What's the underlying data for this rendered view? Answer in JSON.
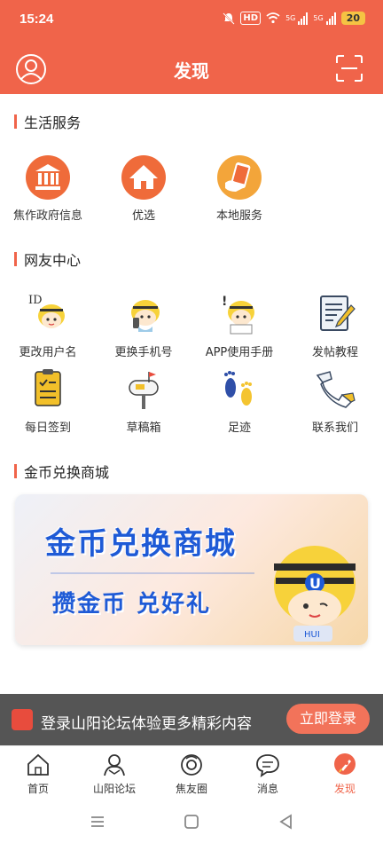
{
  "status": {
    "time": "15:24",
    "hd": "HD",
    "net1": "5G",
    "net2": "5G",
    "battery": "20"
  },
  "header": {
    "title": "发现",
    "avatar_icon": "user-avatar-icon",
    "scan_icon": "scan-icon"
  },
  "sections": {
    "life": {
      "title": "生活服务",
      "items": [
        {
          "label": "焦作政府信息",
          "icon": "government-building-icon"
        },
        {
          "label": "优选",
          "icon": "home-icon"
        },
        {
          "label": "本地服务",
          "icon": "local-service-icon"
        }
      ]
    },
    "community": {
      "title": "网友中心",
      "items": [
        {
          "label": "更改用户名",
          "icon": "mascot-id-icon"
        },
        {
          "label": "更换手机号",
          "icon": "mascot-phone-icon"
        },
        {
          "label": "APP使用手册",
          "icon": "mascot-manual-icon"
        },
        {
          "label": "发帖教程",
          "icon": "post-tutorial-icon"
        },
        {
          "label": "每日签到",
          "icon": "checkin-clipboard-icon"
        },
        {
          "label": "草稿箱",
          "icon": "mailbox-icon"
        },
        {
          "label": "足迹",
          "icon": "footprints-icon"
        },
        {
          "label": "联系我们",
          "icon": "contact-us-icon"
        }
      ]
    },
    "mall": {
      "title": "金币兑换商城",
      "banner_title": "金币兑换商城",
      "banner_sub": "攒金币  兑好礼",
      "banner_badge": "HUI"
    }
  },
  "login_bar": {
    "text": "登录山阳论坛体验更多精彩内容",
    "button": "立即登录"
  },
  "tabs": [
    {
      "label": "首页",
      "icon": "home-outline-icon"
    },
    {
      "label": "山阳论坛",
      "icon": "forum-icon"
    },
    {
      "label": "焦友圈",
      "icon": "circle-icon"
    },
    {
      "label": "消息",
      "icon": "message-icon"
    },
    {
      "label": "发现",
      "icon": "discover-rocket-icon"
    }
  ],
  "colors": {
    "accent": "#f0644a",
    "banner_text": "#1e5ad6",
    "login_bar": "#555555"
  }
}
